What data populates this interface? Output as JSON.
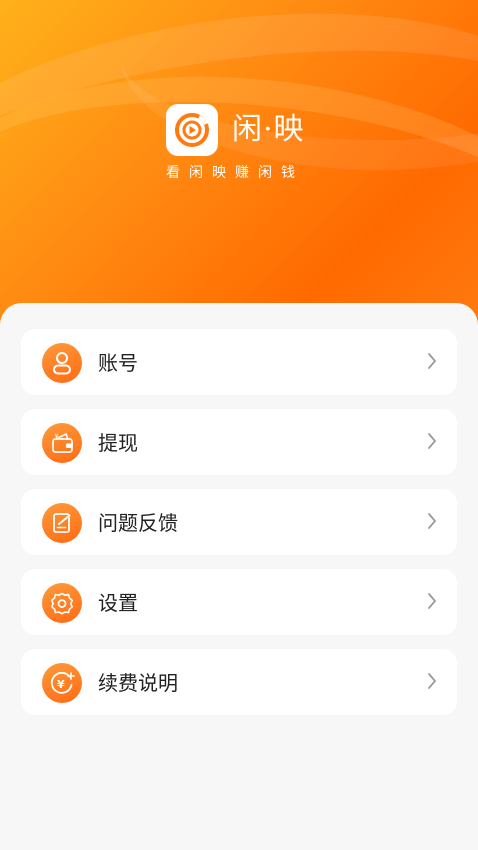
{
  "header": {
    "app_name": "闲·映",
    "slogan": "看闲映赚闲钱"
  },
  "menu": [
    {
      "label": "账号",
      "icon": "user-icon"
    },
    {
      "label": "提现",
      "icon": "wallet-icon"
    },
    {
      "label": "问题反馈",
      "icon": "feedback-icon"
    },
    {
      "label": "设置",
      "icon": "gear-icon"
    },
    {
      "label": "续费说明",
      "icon": "yuan-coin-icon"
    }
  ],
  "colors": {
    "accent": "#ff7a10",
    "header_start": "#ffb11a",
    "header_end": "#ff6a00",
    "text": "#222222",
    "chevron": "#9a9a9a"
  }
}
